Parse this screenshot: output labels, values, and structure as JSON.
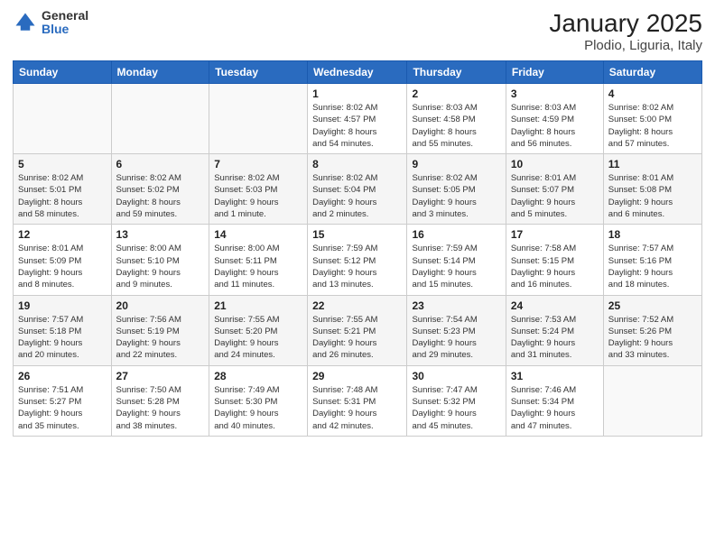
{
  "logo": {
    "general": "General",
    "blue": "Blue"
  },
  "header": {
    "title": "January 2025",
    "subtitle": "Plodio, Liguria, Italy"
  },
  "weekdays": [
    "Sunday",
    "Monday",
    "Tuesday",
    "Wednesday",
    "Thursday",
    "Friday",
    "Saturday"
  ],
  "weeks": [
    [
      {
        "day": "",
        "info": ""
      },
      {
        "day": "",
        "info": ""
      },
      {
        "day": "",
        "info": ""
      },
      {
        "day": "1",
        "info": "Sunrise: 8:02 AM\nSunset: 4:57 PM\nDaylight: 8 hours\nand 54 minutes."
      },
      {
        "day": "2",
        "info": "Sunrise: 8:03 AM\nSunset: 4:58 PM\nDaylight: 8 hours\nand 55 minutes."
      },
      {
        "day": "3",
        "info": "Sunrise: 8:03 AM\nSunset: 4:59 PM\nDaylight: 8 hours\nand 56 minutes."
      },
      {
        "day": "4",
        "info": "Sunrise: 8:02 AM\nSunset: 5:00 PM\nDaylight: 8 hours\nand 57 minutes."
      }
    ],
    [
      {
        "day": "5",
        "info": "Sunrise: 8:02 AM\nSunset: 5:01 PM\nDaylight: 8 hours\nand 58 minutes."
      },
      {
        "day": "6",
        "info": "Sunrise: 8:02 AM\nSunset: 5:02 PM\nDaylight: 8 hours\nand 59 minutes."
      },
      {
        "day": "7",
        "info": "Sunrise: 8:02 AM\nSunset: 5:03 PM\nDaylight: 9 hours\nand 1 minute."
      },
      {
        "day": "8",
        "info": "Sunrise: 8:02 AM\nSunset: 5:04 PM\nDaylight: 9 hours\nand 2 minutes."
      },
      {
        "day": "9",
        "info": "Sunrise: 8:02 AM\nSunset: 5:05 PM\nDaylight: 9 hours\nand 3 minutes."
      },
      {
        "day": "10",
        "info": "Sunrise: 8:01 AM\nSunset: 5:07 PM\nDaylight: 9 hours\nand 5 minutes."
      },
      {
        "day": "11",
        "info": "Sunrise: 8:01 AM\nSunset: 5:08 PM\nDaylight: 9 hours\nand 6 minutes."
      }
    ],
    [
      {
        "day": "12",
        "info": "Sunrise: 8:01 AM\nSunset: 5:09 PM\nDaylight: 9 hours\nand 8 minutes."
      },
      {
        "day": "13",
        "info": "Sunrise: 8:00 AM\nSunset: 5:10 PM\nDaylight: 9 hours\nand 9 minutes."
      },
      {
        "day": "14",
        "info": "Sunrise: 8:00 AM\nSunset: 5:11 PM\nDaylight: 9 hours\nand 11 minutes."
      },
      {
        "day": "15",
        "info": "Sunrise: 7:59 AM\nSunset: 5:12 PM\nDaylight: 9 hours\nand 13 minutes."
      },
      {
        "day": "16",
        "info": "Sunrise: 7:59 AM\nSunset: 5:14 PM\nDaylight: 9 hours\nand 15 minutes."
      },
      {
        "day": "17",
        "info": "Sunrise: 7:58 AM\nSunset: 5:15 PM\nDaylight: 9 hours\nand 16 minutes."
      },
      {
        "day": "18",
        "info": "Sunrise: 7:57 AM\nSunset: 5:16 PM\nDaylight: 9 hours\nand 18 minutes."
      }
    ],
    [
      {
        "day": "19",
        "info": "Sunrise: 7:57 AM\nSunset: 5:18 PM\nDaylight: 9 hours\nand 20 minutes."
      },
      {
        "day": "20",
        "info": "Sunrise: 7:56 AM\nSunset: 5:19 PM\nDaylight: 9 hours\nand 22 minutes."
      },
      {
        "day": "21",
        "info": "Sunrise: 7:55 AM\nSunset: 5:20 PM\nDaylight: 9 hours\nand 24 minutes."
      },
      {
        "day": "22",
        "info": "Sunrise: 7:55 AM\nSunset: 5:21 PM\nDaylight: 9 hours\nand 26 minutes."
      },
      {
        "day": "23",
        "info": "Sunrise: 7:54 AM\nSunset: 5:23 PM\nDaylight: 9 hours\nand 29 minutes."
      },
      {
        "day": "24",
        "info": "Sunrise: 7:53 AM\nSunset: 5:24 PM\nDaylight: 9 hours\nand 31 minutes."
      },
      {
        "day": "25",
        "info": "Sunrise: 7:52 AM\nSunset: 5:26 PM\nDaylight: 9 hours\nand 33 minutes."
      }
    ],
    [
      {
        "day": "26",
        "info": "Sunrise: 7:51 AM\nSunset: 5:27 PM\nDaylight: 9 hours\nand 35 minutes."
      },
      {
        "day": "27",
        "info": "Sunrise: 7:50 AM\nSunset: 5:28 PM\nDaylight: 9 hours\nand 38 minutes."
      },
      {
        "day": "28",
        "info": "Sunrise: 7:49 AM\nSunset: 5:30 PM\nDaylight: 9 hours\nand 40 minutes."
      },
      {
        "day": "29",
        "info": "Sunrise: 7:48 AM\nSunset: 5:31 PM\nDaylight: 9 hours\nand 42 minutes."
      },
      {
        "day": "30",
        "info": "Sunrise: 7:47 AM\nSunset: 5:32 PM\nDaylight: 9 hours\nand 45 minutes."
      },
      {
        "day": "31",
        "info": "Sunrise: 7:46 AM\nSunset: 5:34 PM\nDaylight: 9 hours\nand 47 minutes."
      },
      {
        "day": "",
        "info": ""
      }
    ]
  ]
}
